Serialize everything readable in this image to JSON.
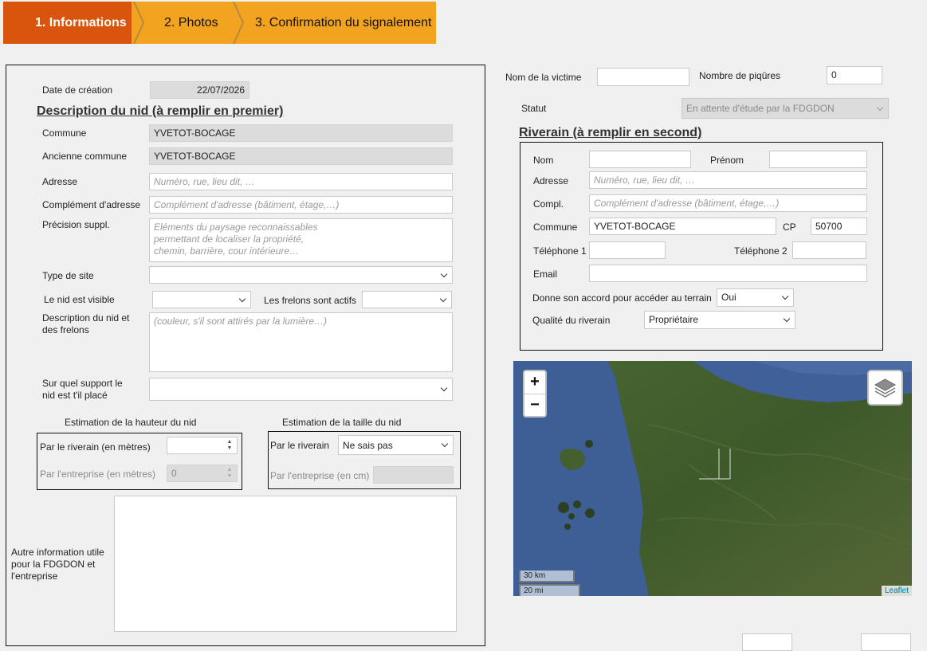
{
  "wizard": {
    "steps": [
      "1. Informations",
      "2. Photos",
      "3. Confirmation du signalement"
    ]
  },
  "left": {
    "date_label": "Date de création",
    "date_value": "22/07/2026",
    "section_title": "Description du nid (à remplir en premier)",
    "commune_label": "Commune",
    "commune_value": "YVETOT-BOCAGE",
    "ancienne_label": "Ancienne commune",
    "ancienne_value": "YVETOT-BOCAGE",
    "adresse_label": "Adresse",
    "adresse_placeholder": "Numéro, rue, lieu dit, …",
    "complement_label": "Complément d'adresse",
    "complement_placeholder": "Complément d'adresse (bâtiment, étage,…)",
    "precision_label": "Précision suppl.",
    "precision_placeholder": [
      "Eléments du paysage reconnaissables",
      "permettant de localiser la propriété,",
      "chemin, barrière, cour intérieure…"
    ],
    "type_site_label": "Type de site",
    "type_site_value": "",
    "nid_visible_label": "Le nid est visible",
    "nid_visible_value": "",
    "frelons_actifs_label": "Les frelons sont actifs",
    "frelons_actifs_value": "",
    "description_label": "Description du nid et des frelons",
    "description_placeholder": "(couleur, s'il sont attirés par la lumière…)",
    "support_label": "Sur quel support le nid est t'il placé",
    "support_value": "",
    "hauteur_title": "Estimation de la hauteur du nid",
    "hauteur_riverain_label": "Par le riverain (en mètres)",
    "hauteur_riverain_value": "",
    "hauteur_entreprise_label": "Par l'entreprise (en mètres)",
    "hauteur_entreprise_value": "0",
    "taille_title": "Estimation de la taille du nid",
    "taille_riverain_label": "Par le riverain",
    "taille_riverain_value": "Ne sais pas",
    "taille_entreprise_label": "Par l'entreprise (en cm)",
    "taille_entreprise_value": "",
    "autre_label": "Autre information utile pour la FDGDON et l'entreprise",
    "autre_value": ""
  },
  "right": {
    "victime_label": "Nom de la victime",
    "victime_value": "",
    "piqures_label": "Nombre de piqûres",
    "piqures_value": "0",
    "statut_label": "Statut",
    "statut_value": "En attente d'étude par la FDGDON",
    "riverain_title": "Riverain (à remplir en second)",
    "nom_label": "Nom",
    "nom_value": "",
    "prenom_label": "Prénom",
    "prenom_value": "",
    "adresse_label": "Adresse",
    "adresse_placeholder": "Numéro, rue, lieu dit, …",
    "compl_label": "Compl.",
    "compl_placeholder": "Complément d'adresse (bâtiment, étage,…)",
    "commune_label": "Commune",
    "commune_value": "YVETOT-BOCAGE",
    "cp_label": "CP",
    "cp_value": "50700",
    "tel1_label": "Téléphone 1",
    "tel1_value": "",
    "tel2_label": "Téléphone 2",
    "tel2_value": "",
    "email_label": "Email",
    "email_value": "",
    "accord_label": "Donne son accord pour accéder au terrain",
    "accord_value": "Oui",
    "qualite_label": "Qualité du riverain",
    "qualite_value": "Propriétaire"
  },
  "map": {
    "zoom_in": "+",
    "zoom_out": "−",
    "scale_km": "30 km",
    "scale_mi": "20 mi",
    "attribution": "Leaflet",
    "colors": {
      "sea": "#3e5f96",
      "land": "#3f5a2c"
    }
  }
}
